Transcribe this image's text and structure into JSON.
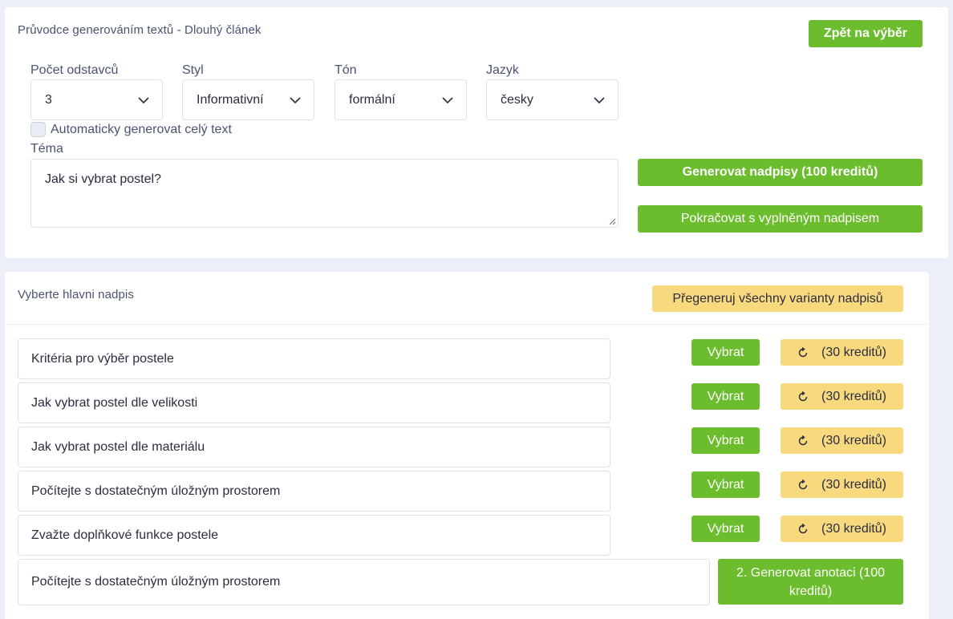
{
  "wizard": {
    "title": "Průvodce generováním textů - Dlouhý článek",
    "back_button": "Zpět na výběr",
    "fields": [
      {
        "label": "Počet odstavců",
        "value": "3"
      },
      {
        "label": "Styl",
        "value": "Informativní"
      },
      {
        "label": "Tón",
        "value": "formální"
      },
      {
        "label": "Jazyk",
        "value": "česky"
      }
    ],
    "auto_generate_label": "Automaticky generovat celý text",
    "auto_generate_checked": false,
    "topic_label": "Téma",
    "topic_value": "Jak si vybrat postel?",
    "generate_headings_button": "Generovat nadpisy (100 kreditů)",
    "continue_button": "Pokračovat s vyplněným nadpisem"
  },
  "headings": {
    "title": "Vyberte hlavni nadpis",
    "regenerate_all_button": "Přegeneruj všechny varianty nadpisů",
    "select_label": "Vybrat",
    "regenerate_label": "(30 kreditů)",
    "regenerate_icon": "refresh-icon",
    "items": [
      "Kritéria pro výběr postele",
      "Jak vybrat postel dle velikosti",
      "Jak vybrat postel dle materiálu",
      "Počítejte s dostatečným úložným prostorem",
      "Zvažte doplňkové funkce postele"
    ],
    "selected_value": "Počítejte s dostatečným úložným prostorem",
    "generate_annotation_button": "2. Generovat anotaci (100 kreditů)"
  },
  "colors": {
    "green": "#6bbd2e",
    "yellow": "#f9d97e",
    "background": "#eceff8"
  }
}
